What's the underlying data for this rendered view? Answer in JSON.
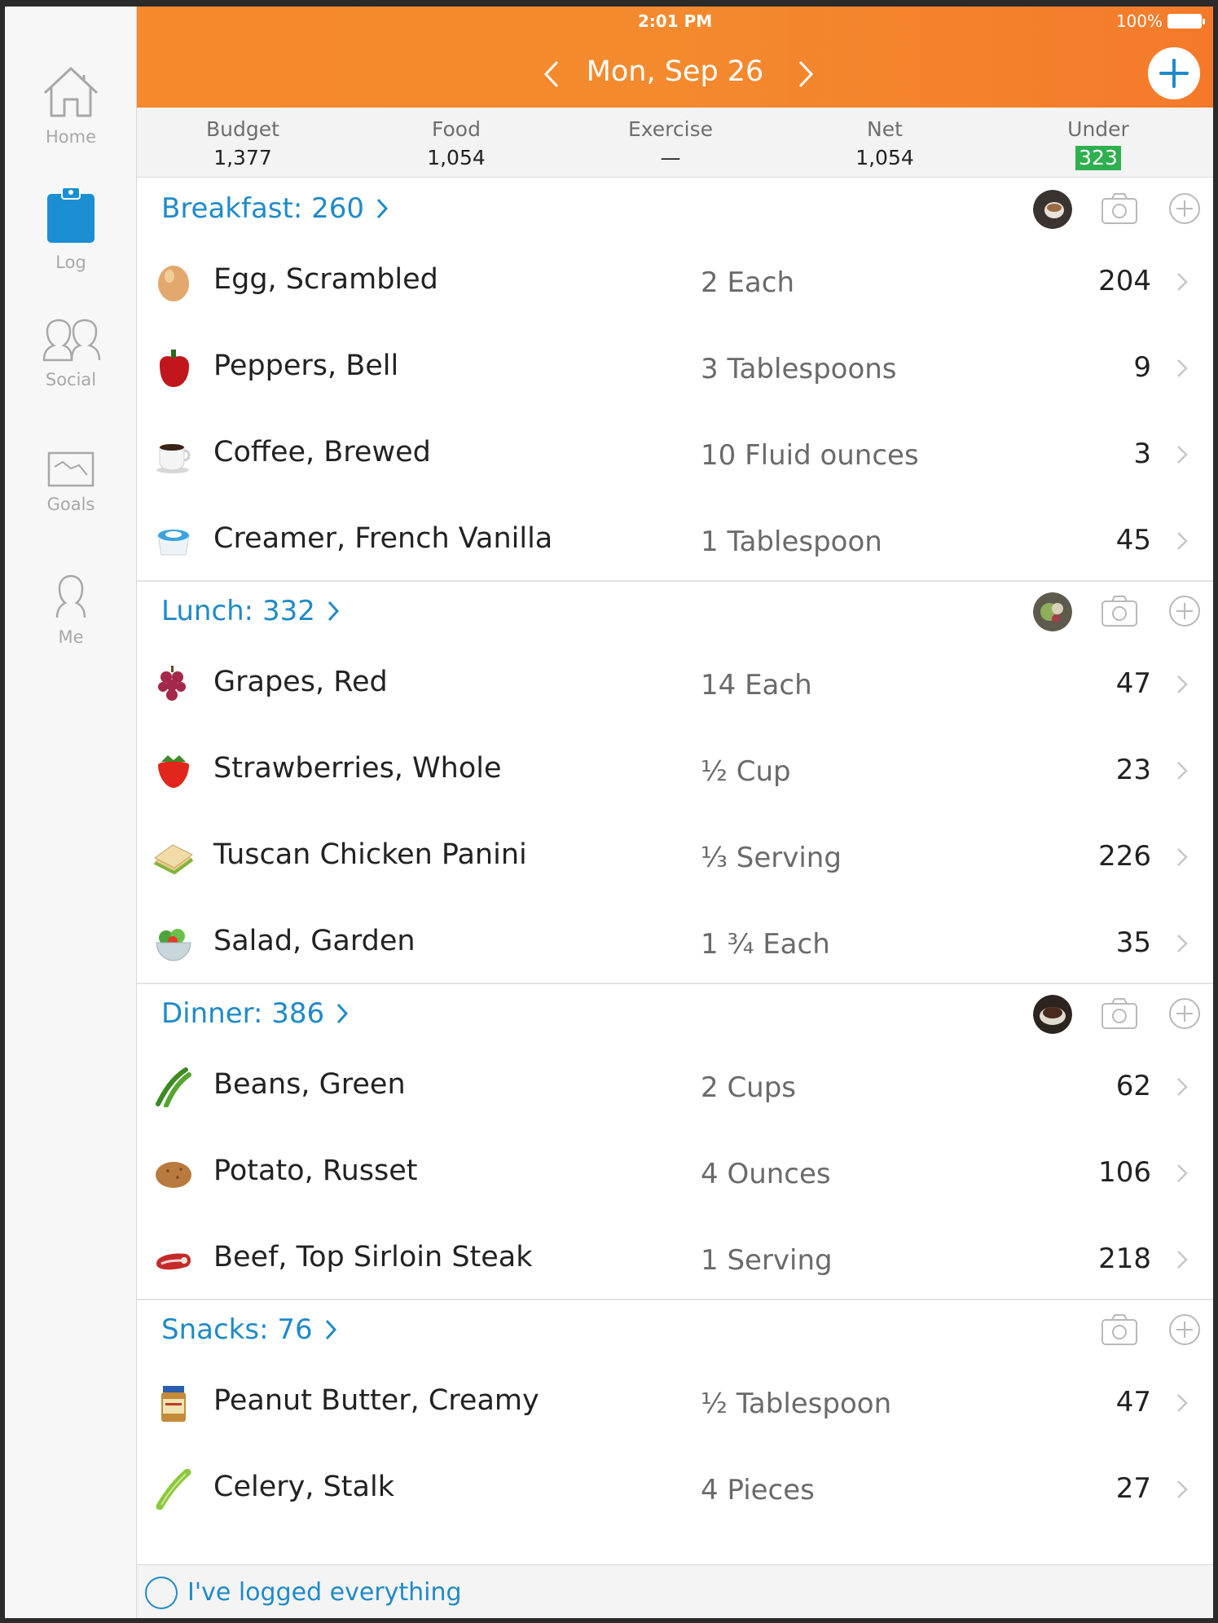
{
  "status": {
    "time": "2:01 PM",
    "battery": "100%"
  },
  "header": {
    "date": "Mon, Sep 26"
  },
  "sidebar": {
    "items": [
      {
        "label": "Home",
        "icon": "home-icon"
      },
      {
        "label": "Log",
        "icon": "clipboard-icon",
        "active": true
      },
      {
        "label": "Social",
        "icon": "people-icon"
      },
      {
        "label": "Goals",
        "icon": "chart-icon"
      },
      {
        "label": "Me",
        "icon": "person-icon"
      }
    ]
  },
  "summary": {
    "budget_label": "Budget",
    "budget_value": "1,377",
    "food_label": "Food",
    "food_value": "1,054",
    "exercise_label": "Exercise",
    "exercise_value": "—",
    "net_label": "Net",
    "net_value": "1,054",
    "under_label": "Under",
    "under_value": "323"
  },
  "meals": {
    "breakfast": {
      "title": "Breakfast: 260",
      "items": [
        {
          "name": "Egg, Scrambled",
          "qty": "2 Each",
          "cal": "204"
        },
        {
          "name": "Peppers, Bell",
          "qty": "3 Tablespoons",
          "cal": "9"
        },
        {
          "name": "Coffee, Brewed",
          "qty": "10 Fluid ounces",
          "cal": "3"
        },
        {
          "name": "Creamer, French Vanilla",
          "qty": "1 Tablespoon",
          "cal": "45"
        }
      ]
    },
    "lunch": {
      "title": "Lunch: 332",
      "items": [
        {
          "name": "Grapes, Red",
          "qty": "14 Each",
          "cal": "47"
        },
        {
          "name": "Strawberries, Whole",
          "qty": "½ Cup",
          "cal": "23"
        },
        {
          "name": "Tuscan Chicken Panini",
          "qty": "⅓ Serving",
          "cal": "226"
        },
        {
          "name": "Salad, Garden",
          "qty": "1 ¾ Each",
          "cal": "35"
        }
      ]
    },
    "dinner": {
      "title": "Dinner: 386",
      "items": [
        {
          "name": "Beans, Green",
          "qty": "2 Cups",
          "cal": "62"
        },
        {
          "name": "Potato, Russet",
          "qty": "4 Ounces",
          "cal": "106"
        },
        {
          "name": "Beef, Top Sirloin Steak",
          "qty": "1 Serving",
          "cal": "218"
        }
      ]
    },
    "snacks": {
      "title": "Snacks: 76",
      "items": [
        {
          "name": "Peanut Butter, Creamy",
          "qty": "½ Tablespoon",
          "cal": "47"
        },
        {
          "name": "Celery, Stalk",
          "qty": "4 Pieces",
          "cal": "27"
        }
      ]
    }
  },
  "footer": {
    "logged_label": "I've logged everything"
  },
  "colors": {
    "header_orange": "#f6892c",
    "link_blue": "#1f8ac9",
    "under_green": "#2fb04f"
  }
}
